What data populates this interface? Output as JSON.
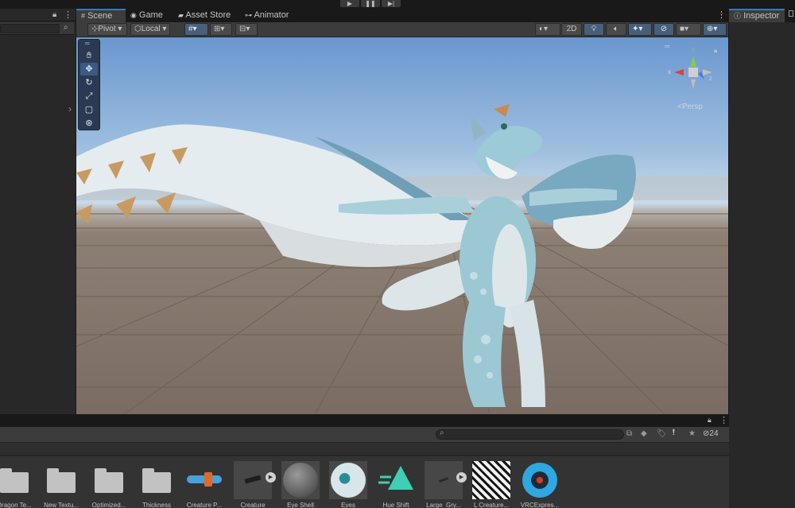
{
  "playbar": {
    "play": "▶",
    "pause": "❚❚",
    "step": "▶|"
  },
  "scene_tabs": [
    {
      "label": "Scene",
      "icon": "grid-icon"
    },
    {
      "label": "Game",
      "icon": "gamepad-icon"
    },
    {
      "label": "Asset Store",
      "icon": "store-icon"
    },
    {
      "label": "Animator",
      "icon": "animator-icon"
    }
  ],
  "scene_toolbar": {
    "pivot_label": "Pivot",
    "local_label": "Local",
    "mode_2d_label": "2D",
    "perspective_label": "<Persp",
    "hidden_count": "24"
  },
  "gizmo": {
    "y": "y",
    "x": "x",
    "z": "z"
  },
  "inspector": {
    "tab_label": "Inspector"
  },
  "assets": [
    {
      "label": "Dragon Te...",
      "type": "folder"
    },
    {
      "label": "New Textu...",
      "type": "folder"
    },
    {
      "label": "Optimized...",
      "type": "folder"
    },
    {
      "label": "Thickness",
      "type": "folder"
    },
    {
      "label": "Creature P...",
      "type": "prefab"
    },
    {
      "label": "Creature",
      "type": "model"
    },
    {
      "label": "Eye Shell",
      "type": "material"
    },
    {
      "label": "Eyes",
      "type": "material"
    },
    {
      "label": "Hue Shift",
      "type": "shader"
    },
    {
      "label": "Large_Gry...",
      "type": "model"
    },
    {
      "label": "L Creature...",
      "type": "texture"
    },
    {
      "label": "VRCExpres...",
      "type": "asset"
    }
  ],
  "colors": {
    "accent": "#3a79bb",
    "panel": "#282828",
    "toolbar": "#3c3c3c",
    "sky": "#9fbfe0",
    "ground": "#7a6c62",
    "creature_body": "#9cc8d4"
  }
}
